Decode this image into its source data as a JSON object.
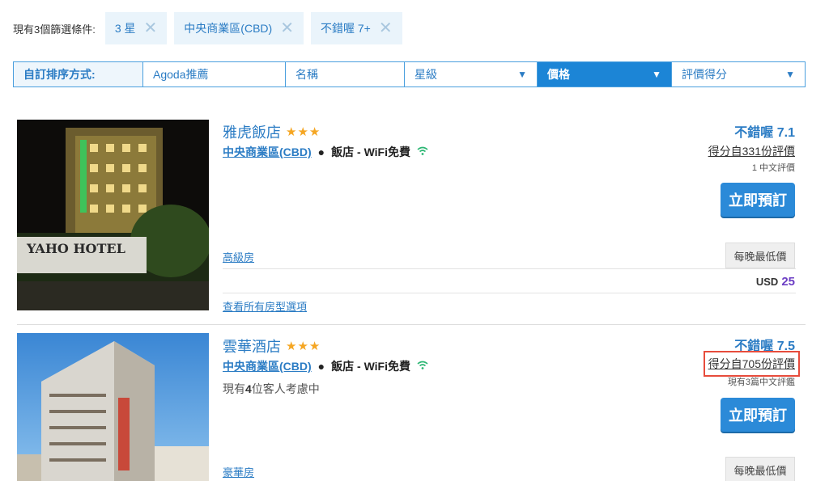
{
  "filters": {
    "label": "現有3個篩選條件:",
    "chips": [
      "3 星",
      "中央商業區(CBD)",
      "不錯喔 7+"
    ]
  },
  "sort": {
    "label": "自訂排序方式:",
    "options": [
      "Agoda推薦",
      "名稱",
      "星級",
      "價格",
      "評價得分"
    ],
    "active": "價格"
  },
  "hotels": [
    {
      "name": "雅虎飯店",
      "stars": "★★★",
      "area": "中央商業區(CBD)",
      "type": "飯店 - WiFi免費",
      "rating_word": "不錯喔 7.1",
      "reviews": "得分自331份評價",
      "review_sub": "1 中文評價",
      "book_label": "立即預訂",
      "room": "高級房",
      "lowest_label": "每晚最低價",
      "currency": "USD",
      "price": "25",
      "all_rooms": "查看所有房型選項",
      "photo_sign": "YAHO HOTEL"
    },
    {
      "name": "雲華酒店",
      "stars": "★★★",
      "area": "中央商業區(CBD)",
      "type": "飯店 - WiFi免費",
      "viewers_prefix": "現有",
      "viewers_count": "4",
      "viewers_suffix": "位客人考慮中",
      "rating_word": "不錯喔 7.5",
      "reviews": "得分自705份評價",
      "review_sub": "現有3篇中文評鑑",
      "book_label": "立即預訂",
      "room": "豪華房",
      "lowest_label": "每晚最低價"
    }
  ],
  "icons": {
    "close": "close-icon",
    "chevron": "chevron-down-icon",
    "wifi": "wifi-icon",
    "star": "star-icon"
  }
}
